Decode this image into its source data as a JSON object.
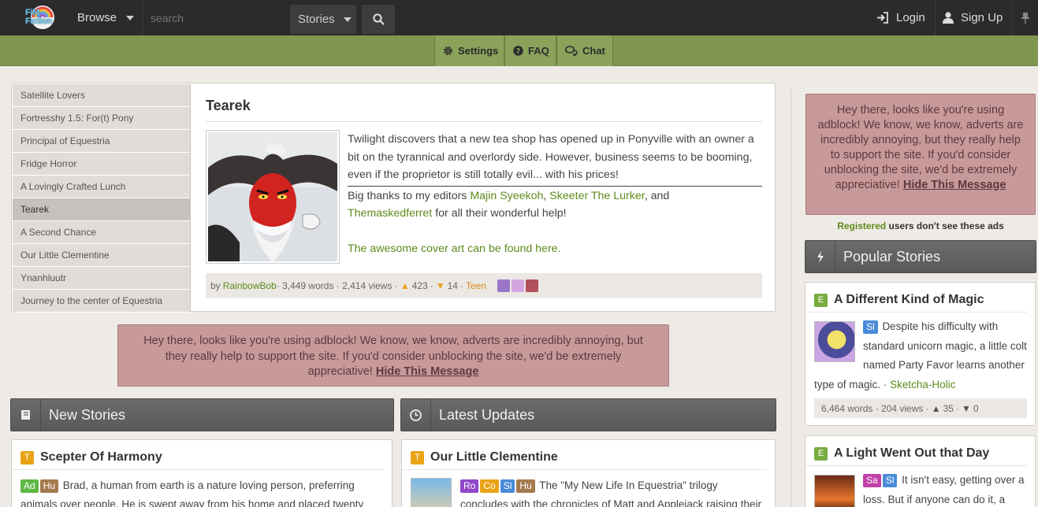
{
  "header": {
    "logo_text_1": "FiM",
    "logo_text_2": "Fiction",
    "browse_label": "Browse",
    "search_placeholder": "search",
    "search_type": "Stories",
    "login_label": "Login",
    "signup_label": "Sign Up"
  },
  "subnav": {
    "settings_label": "Settings",
    "faq_label": "FAQ",
    "chat_label": "Chat"
  },
  "featured": {
    "list": [
      "Satellite Lovers",
      "Fortresshy 1.5: For(t) Pony",
      "Principal of Equestria",
      "Fridge Horror",
      "A Lovingly Crafted Lunch",
      "Tearek",
      "A Second Chance",
      "Our Little Clementine",
      "Ynanhluutr",
      "Journey to the center of Equestria"
    ],
    "active_index": 5,
    "title": "Tearek",
    "description": "Twilight discovers that a new tea shop has opened up in Ponyville with an owner a bit on the tyrannical and overlordy side. However, business seems to be booming, even if the proprietor is still totally evil... with his prices!",
    "thanks_prefix": "Big thanks to my editors ",
    "editor_1": "Majin Syeekoh",
    "sep_1": ", ",
    "editor_2": "Skeeter The Lurker",
    "sep_2": ", and",
    "editor_3": "Themaskedferret",
    "thanks_suffix": " for all their wonderful help!",
    "cover_link": "The awesome cover art can be found here.",
    "meta_by": "by ",
    "author": "RainbowBob",
    "words": " · 3,449 words · 2,414 views · ",
    "likes": "423",
    "dislikes": "14",
    "rating": "Teen"
  },
  "adblock": {
    "text": "Hey there, looks like you're using adblock! We know, we know, adverts are incredibly annoying, but they really help to support the site. If you'd consider unblocking the site, we'd be extremely appreciative!",
    "hide_label": "Hide This Message"
  },
  "sidebar_ad": {
    "registered_label": "Registered",
    "registered_suffix": " users don't see these ads"
  },
  "sections": {
    "new_stories": "New Stories",
    "latest_updates": "Latest Updates",
    "popular_stories": "Popular Stories"
  },
  "new_story": {
    "rating": "T",
    "title": "Scepter Of Harmony",
    "tags": [
      "Ad",
      "Hu"
    ],
    "text": "Brad, a human from earth is a nature loving person, preferring animals over people. He is swept away from his home and placed twenty"
  },
  "latest_update": {
    "rating": "T",
    "title": "Our Little Clementine",
    "tags": [
      "Ro",
      "Co",
      "Sl",
      "Hu"
    ],
    "text": "The \"My New Life In Equestria\" trilogy concludes with the chronicles of Matt and Applejack raising their"
  },
  "popular": [
    {
      "rating": "E",
      "title": "A Different Kind of Magic",
      "tags": [
        "Sl"
      ],
      "text": "Despite his difficulty with standard unicorn magic, a little colt named Party Favor learns another type of magic.",
      "author": "Sketcha-Holic",
      "meta": "6,464 words · 204 views · ",
      "likes": "35",
      "dislikes": "0"
    },
    {
      "rating": "E",
      "title": "A Light Went Out that Day",
      "tags": [
        "Sa",
        "Sl"
      ],
      "text": "It isn't easy, getting over a loss. But if anyone can do it, a"
    }
  ],
  "colors": {
    "topbar": "#2b2b2b",
    "greenbar": "#7f9650",
    "link_green": "#5e8a1b",
    "ad_bg": "#c8999b",
    "teen_orange": "#e8a317",
    "everyone_green": "#78ac40"
  }
}
